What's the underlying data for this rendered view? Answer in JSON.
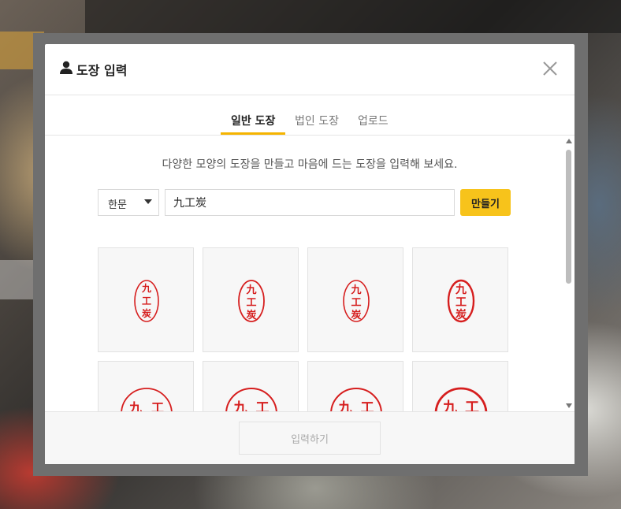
{
  "dialog": {
    "title": "도장 입력",
    "tabs": [
      {
        "label": "일반 도장",
        "active": true
      },
      {
        "label": "법인 도장",
        "active": false
      },
      {
        "label": "업로드",
        "active": false
      }
    ],
    "description": "다양한 모양의 도장을 만들고 마음에 드는 도장을 입력해 보세요.",
    "script_select": {
      "selected": "한문"
    },
    "name_input": {
      "value": "九工炭"
    },
    "make_button": "만들기",
    "submit_button": "입력하기"
  },
  "stamps": [
    {
      "shape": "oval",
      "style": "seal-script",
      "text": "九工炭"
    },
    {
      "shape": "oval",
      "style": "serif",
      "text": "九工炭"
    },
    {
      "shape": "oval",
      "style": "serif-light",
      "text": "九工炭"
    },
    {
      "shape": "oval",
      "style": "bold",
      "text": "九工炭"
    },
    {
      "shape": "circle",
      "style": "seal-script",
      "text": "九工炭"
    },
    {
      "shape": "circle",
      "style": "serif",
      "text": "九工炭"
    },
    {
      "shape": "circle",
      "style": "serif-light",
      "text": "九工炭"
    },
    {
      "shape": "circle",
      "style": "bold",
      "text": "九工炭"
    }
  ],
  "colors": {
    "accent": "#f7c31b",
    "stamp_red": "#d61e1e",
    "tab_underline": "#f5b400"
  }
}
